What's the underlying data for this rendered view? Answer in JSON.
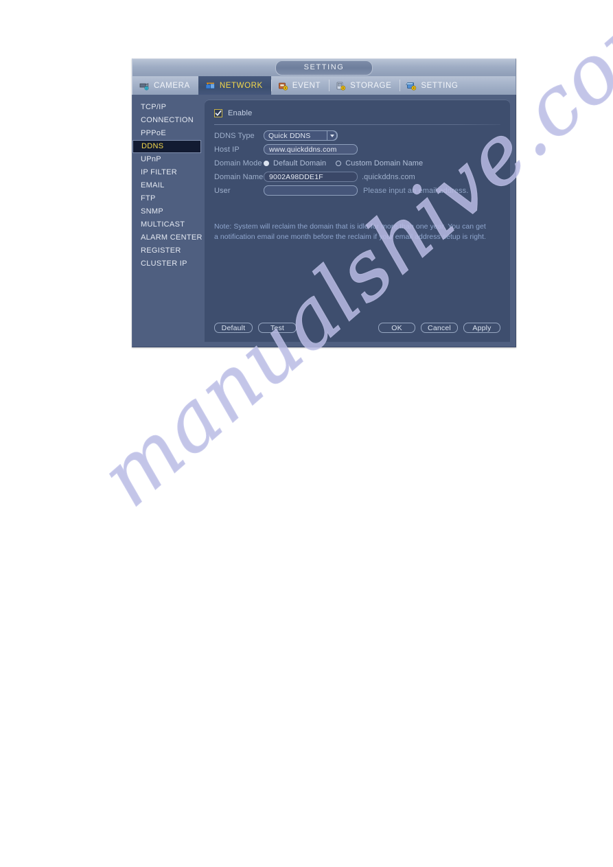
{
  "window": {
    "title": "SETTING",
    "tabs": [
      {
        "label": "CAMERA",
        "icon": "camera-icon",
        "active": false
      },
      {
        "label": "NETWORK",
        "icon": "network-icon",
        "active": true
      },
      {
        "label": "EVENT",
        "icon": "event-icon",
        "active": false
      },
      {
        "label": "STORAGE",
        "icon": "storage-icon",
        "active": false
      },
      {
        "label": "SETTING",
        "icon": "setting-icon",
        "active": false
      }
    ]
  },
  "sidebar": {
    "items": [
      {
        "label": "TCP/IP",
        "selected": false
      },
      {
        "label": "CONNECTION",
        "selected": false
      },
      {
        "label": "PPPoE",
        "selected": false
      },
      {
        "label": "DDNS",
        "selected": true
      },
      {
        "label": "UPnP",
        "selected": false
      },
      {
        "label": "IP FILTER",
        "selected": false
      },
      {
        "label": "EMAIL",
        "selected": false
      },
      {
        "label": "FTP",
        "selected": false
      },
      {
        "label": "SNMP",
        "selected": false
      },
      {
        "label": "MULTICAST",
        "selected": false
      },
      {
        "label": "ALARM CENTER",
        "selected": false
      },
      {
        "label": "REGISTER",
        "selected": false
      },
      {
        "label": "CLUSTER IP",
        "selected": false
      }
    ]
  },
  "form": {
    "enable": {
      "label": "Enable",
      "checked": true
    },
    "ddns_type": {
      "label": "DDNS Type",
      "value": "Quick DDNS"
    },
    "host_ip": {
      "label": "Host IP",
      "value": "www.quickddns.com"
    },
    "domain_mode": {
      "label": "Domain Mode",
      "options": [
        {
          "label": "Default Domain",
          "selected": true
        },
        {
          "label": "Custom Domain Name",
          "selected": false
        }
      ]
    },
    "domain_name": {
      "label": "Domain Name",
      "value": "9002A98DDE1F",
      "suffix": ".quickddns.com"
    },
    "user": {
      "label": "User",
      "value": "",
      "hint": "Please input an email address."
    },
    "note": "Note: System will reclaim the domain that is idle for more than one year. You can get a notification email one month before the reclaim if your email address setup is right."
  },
  "buttons": {
    "default": "Default",
    "test": "Test",
    "ok": "OK",
    "cancel": "Cancel",
    "apply": "Apply"
  },
  "watermark": {
    "text": "manualshive.com"
  },
  "colors": {
    "accent_yellow": "#f4d84b",
    "panel_bg": "#3e4e6e",
    "window_bg": "#4f5f80",
    "label_blue": "#9fb0cc",
    "note_blue": "#8fa6ce"
  }
}
